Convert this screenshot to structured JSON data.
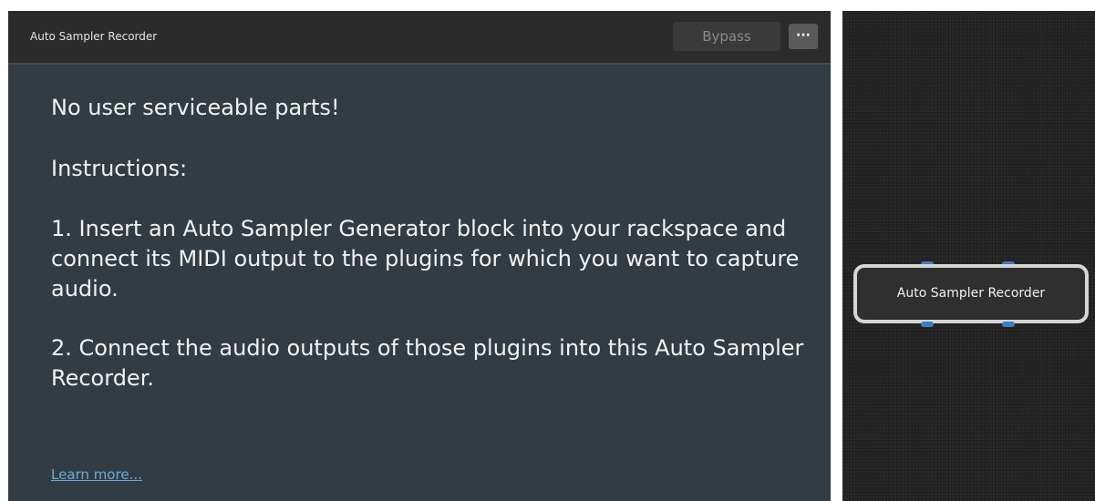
{
  "plugin": {
    "title": "Auto Sampler Recorder",
    "bypass_label": "Bypass",
    "more_label": "···",
    "content": {
      "heading": "No user serviceable parts!",
      "instructions_label": "Instructions:",
      "step_1": "1. Insert an Auto Sampler Generator block into your rackspace and connect its MIDI output to the plugins for which you want to capture audio.",
      "step_2": "2. Connect the audio outputs of those plugins into this Auto Sampler Recorder.",
      "learn_more": "Learn more..."
    }
  },
  "graph": {
    "node_label": "Auto Sampler Recorder"
  },
  "colors": {
    "panel_bg": "#323c44",
    "title_bar_bg": "#2b2b2b",
    "link": "#6fa9d8",
    "port": "#3a7fc4",
    "graph_bg": "#262626"
  }
}
